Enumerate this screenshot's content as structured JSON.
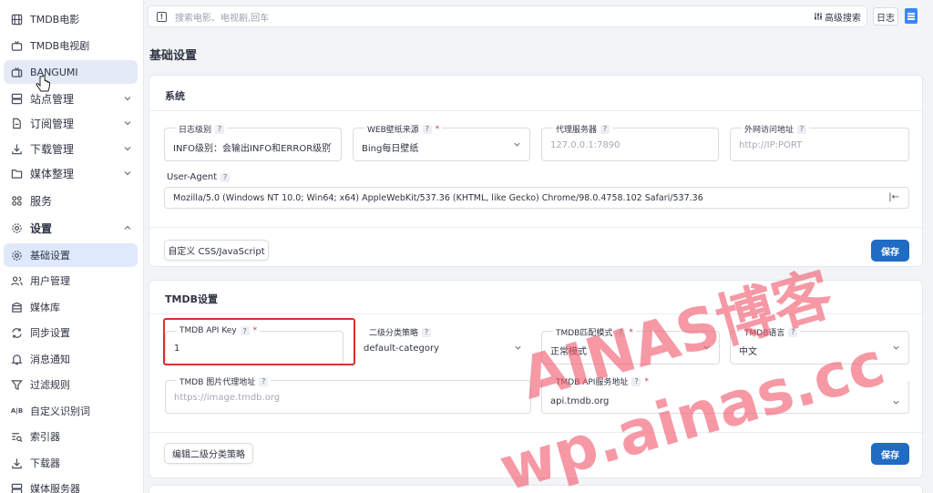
{
  "sidebar": {
    "items": [
      {
        "label": "TMDB电影",
        "icon": "film-icon"
      },
      {
        "label": "TMDB电视剧",
        "icon": "tv-icon"
      },
      {
        "label": "BANGUMI",
        "icon": "tv-icon"
      },
      {
        "label": "站点管理",
        "icon": "server-icon"
      },
      {
        "label": "订阅管理",
        "icon": "file-icon"
      },
      {
        "label": "下载管理",
        "icon": "download-icon"
      },
      {
        "label": "媒体整理",
        "icon": "folder-icon"
      },
      {
        "label": "服务",
        "icon": "grid-icon"
      },
      {
        "label": "设置",
        "icon": "gear-icon"
      },
      {
        "label": "基础设置",
        "icon": "gear-icon"
      },
      {
        "label": "用户管理",
        "icon": "users-icon"
      },
      {
        "label": "媒体库",
        "icon": "library-icon"
      },
      {
        "label": "同步设置",
        "icon": "sync-icon"
      },
      {
        "label": "消息通知",
        "icon": "bell-icon"
      },
      {
        "label": "过滤规则",
        "icon": "filter-icon"
      },
      {
        "label": "自定义识别词",
        "icon": "text-icon"
      },
      {
        "label": "索引器",
        "icon": "list-search-icon"
      },
      {
        "label": "下载器",
        "icon": "download-icon"
      },
      {
        "label": "媒体服务器",
        "icon": "server-icon"
      }
    ]
  },
  "topbar": {
    "search_placeholder": "搜索电影、电视剧,回车",
    "advanced_search": "高级搜索",
    "log_button": "日志"
  },
  "page_title": "基础设置",
  "system": {
    "title": "系统",
    "log_level": {
      "label": "日志级别",
      "value": "INFO级别：会输出INFO和ERROR级别的"
    },
    "wallpaper": {
      "label": "WEB壁纸来源",
      "value": "Bing每日壁纸"
    },
    "proxy": {
      "label": "代理服务器",
      "placeholder": "127.0.0.1:7890"
    },
    "external_url": {
      "label": "外网访问地址",
      "placeholder": "http://IP:PORT"
    },
    "user_agent": {
      "label": "User-Agent",
      "value": "Mozilla/5.0 (Windows NT 10.0; Win64; x64) AppleWebKit/537.36 (KHTML, like Gecko) Chrome/98.0.4758.102 Safari/537.36",
      "icon_text": "|←"
    },
    "custom_css_button": "自定义 CSS/JavaScript",
    "save_button": "保存"
  },
  "tmdb": {
    "title": "TMDB设置",
    "api_key": {
      "label": "TMDB API Key",
      "value": "1"
    },
    "secondary_category": {
      "label": "二级分类策略",
      "value": "default-category"
    },
    "match_mode": {
      "label": "TMDB匹配模式",
      "value": "正常模式"
    },
    "language": {
      "label": "TMDB语言",
      "value": "中文"
    },
    "image_proxy": {
      "label": "TMDB 图片代理地址",
      "placeholder": "https://image.tmdb.org"
    },
    "api_domain": {
      "label": "TMDB API服务地址",
      "value": "api.tmdb.org"
    },
    "edit_category_button": "编辑二级分类策略",
    "save_button": "保存"
  },
  "watermark": {
    "line1": "AINAS博客",
    "line2": "wp.ainas.cc",
    "color": "#f05a6e"
  },
  "colors": {
    "primary": "#206bc4",
    "highlight": "#d8322f",
    "active_nav": "#dfe9fb"
  }
}
